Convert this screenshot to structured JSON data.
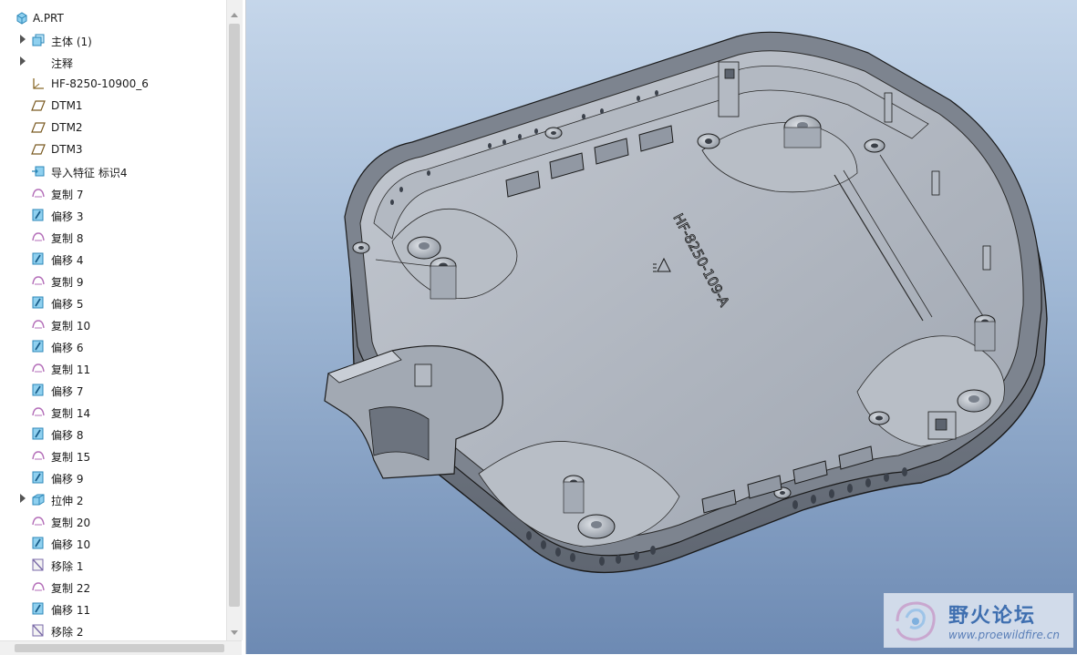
{
  "model_tree": {
    "items": [
      {
        "label": "A.PRT",
        "icon": "part-icon",
        "level": 0,
        "expandable": false
      },
      {
        "label": "主体 (1)",
        "icon": "body-icon",
        "level": 1,
        "expandable": true
      },
      {
        "label": "注释",
        "icon": "",
        "level": 1,
        "expandable": true
      },
      {
        "label": "HF-8250-10900_6",
        "icon": "coordinate-system-icon",
        "level": 1,
        "expandable": false
      },
      {
        "label": "DTM1",
        "icon": "datum-plane-icon",
        "level": 1,
        "expandable": false
      },
      {
        "label": "DTM2",
        "icon": "datum-plane-icon",
        "level": 1,
        "expandable": false
      },
      {
        "label": "DTM3",
        "icon": "datum-plane-icon",
        "level": 1,
        "expandable": false
      },
      {
        "label": "导入特征 标识4",
        "icon": "import-feature-icon",
        "level": 1,
        "expandable": false
      },
      {
        "label": "复制 7",
        "icon": "copy-surface-icon",
        "level": 1,
        "expandable": false
      },
      {
        "label": "偏移 3",
        "icon": "offset-icon",
        "level": 1,
        "expandable": false
      },
      {
        "label": "复制 8",
        "icon": "copy-surface-icon",
        "level": 1,
        "expandable": false
      },
      {
        "label": "偏移 4",
        "icon": "offset-icon",
        "level": 1,
        "expandable": false
      },
      {
        "label": "复制 9",
        "icon": "copy-surface-icon",
        "level": 1,
        "expandable": false
      },
      {
        "label": "偏移 5",
        "icon": "offset-icon",
        "level": 1,
        "expandable": false
      },
      {
        "label": "复制 10",
        "icon": "copy-surface-icon",
        "level": 1,
        "expandable": false
      },
      {
        "label": "偏移 6",
        "icon": "offset-icon",
        "level": 1,
        "expandable": false
      },
      {
        "label": "复制 11",
        "icon": "copy-surface-icon",
        "level": 1,
        "expandable": false
      },
      {
        "label": "偏移 7",
        "icon": "offset-icon",
        "level": 1,
        "expandable": false
      },
      {
        "label": "复制 14",
        "icon": "copy-surface-icon",
        "level": 1,
        "expandable": false
      },
      {
        "label": "偏移 8",
        "icon": "offset-icon",
        "level": 1,
        "expandable": false
      },
      {
        "label": "复制 15",
        "icon": "copy-surface-icon",
        "level": 1,
        "expandable": false
      },
      {
        "label": "偏移 9",
        "icon": "offset-icon",
        "level": 1,
        "expandable": false
      },
      {
        "label": "拉伸 2",
        "icon": "extrude-icon",
        "level": 1,
        "expandable": true
      },
      {
        "label": "复制 20",
        "icon": "copy-surface-icon",
        "level": 1,
        "expandable": false
      },
      {
        "label": "偏移 10",
        "icon": "offset-icon",
        "level": 1,
        "expandable": false
      },
      {
        "label": "移除 1",
        "icon": "remove-icon",
        "level": 1,
        "expandable": false
      },
      {
        "label": "复制 22",
        "icon": "copy-surface-icon",
        "level": 1,
        "expandable": false
      },
      {
        "label": "偏移 11",
        "icon": "offset-icon",
        "level": 1,
        "expandable": false
      },
      {
        "label": "移除 2",
        "icon": "remove-icon",
        "level": 1,
        "expandable": false
      }
    ]
  },
  "viewport": {
    "part_label": "HF-8250-109-A",
    "colors": {
      "background_top": "#c5d6ea",
      "background_bottom": "#6d8ab3",
      "part_shade": "#a9afb9",
      "part_edge": "#1a1a1a"
    }
  },
  "watermark": {
    "title": "野火论坛",
    "url": "www.proewildfire.cn"
  }
}
